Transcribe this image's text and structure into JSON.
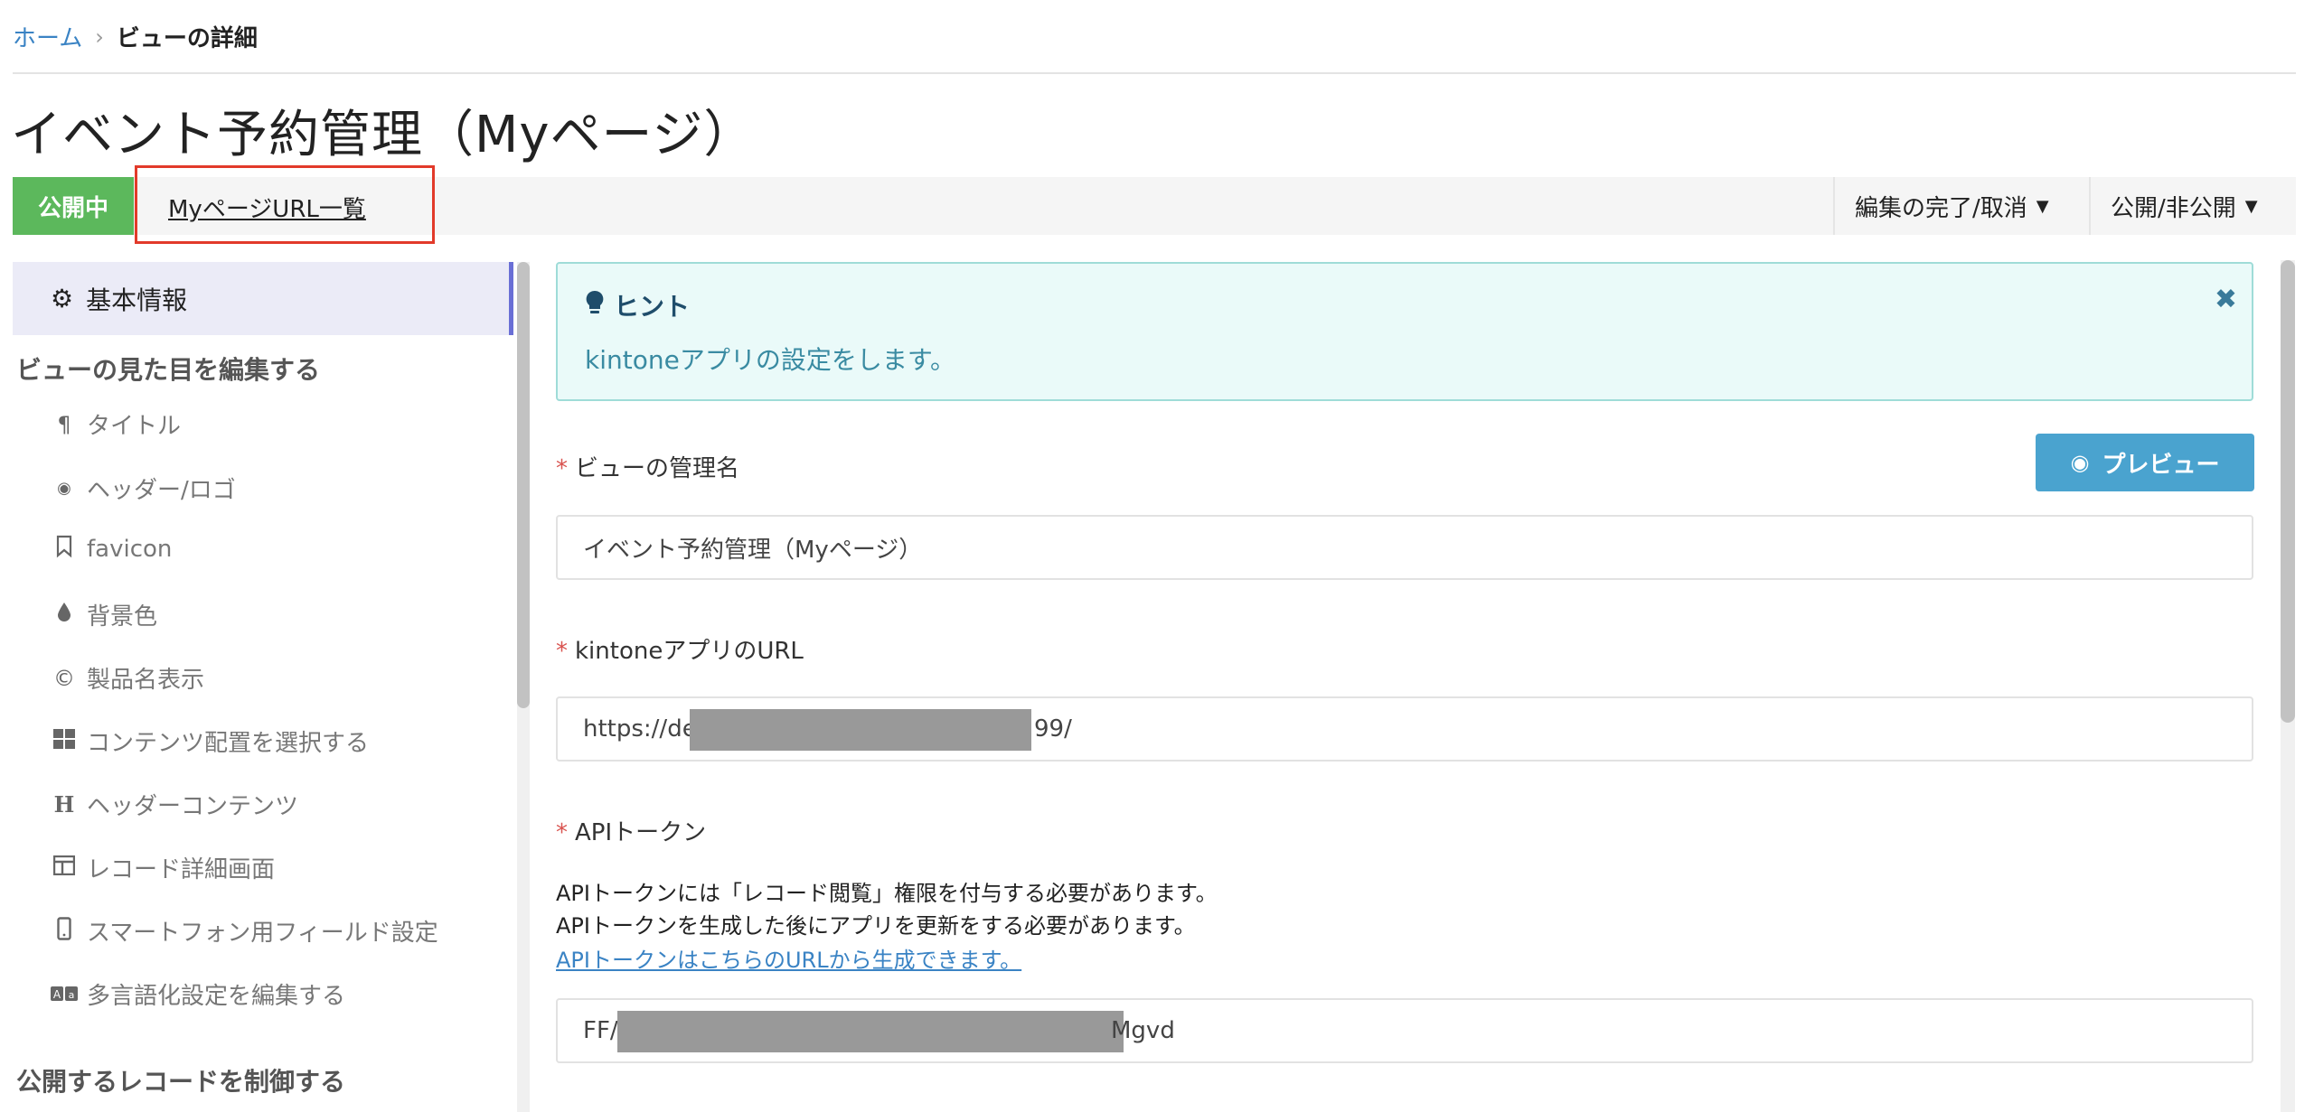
{
  "breadcrumb": {
    "home": "ホーム",
    "separator": "›",
    "current": "ビューの詳細"
  },
  "page_title": "イベント予約管理（Myページ）",
  "toolbar": {
    "status": "公開中",
    "mypage_link": "MyページURL一覧",
    "edit_dropdown": "編集の完了/取消",
    "publish_dropdown": "公開/非公開"
  },
  "sidebar": {
    "active_item": "基本情報",
    "section_appearance": "ビューの見た目を編集する",
    "items": [
      {
        "icon": "paragraph-icon",
        "label": "タイトル"
      },
      {
        "icon": "eye-icon",
        "label": "ヘッダー/ロゴ"
      },
      {
        "icon": "bookmark-icon",
        "label": "favicon"
      },
      {
        "icon": "droplet-icon",
        "label": "背景色"
      },
      {
        "icon": "copyright-icon",
        "label": "製品名表示"
      },
      {
        "icon": "grid-icon",
        "label": "コンテンツ配置を選択する"
      },
      {
        "icon": "header-icon",
        "label": "ヘッダーコンテンツ"
      },
      {
        "icon": "table-icon",
        "label": "レコード詳細画面"
      },
      {
        "icon": "mobile-icon",
        "label": "スマートフォン用フィールド設定"
      },
      {
        "icon": "language-icon",
        "label": "多言語化設定を編集する"
      }
    ],
    "section_records": "公開するレコードを制御する"
  },
  "hint": {
    "title": "ヒント",
    "text": "kintoneアプリの設定をします。"
  },
  "form": {
    "preview_button": "プレビュー",
    "view_name": {
      "label": "ビューの管理名",
      "value": "イベント予約管理（Myページ）"
    },
    "app_url": {
      "label": "kintoneアプリのURL",
      "value_start": "https://de",
      "value_end": "99/"
    },
    "api_token": {
      "label": "APIトークン",
      "help_line1": "APIトークンには「レコード閲覧」権限を付与する必要があります。",
      "help_line2": "APIトークンを生成した後にアプリを更新をする必要があります。",
      "help_link": "APIトークンはこちらのURLから生成できます。",
      "value_start": "FF/",
      "value_end": "Mgvd"
    }
  },
  "colors": {
    "status_green": "#5cb85c",
    "highlight_red": "#e23a2a",
    "accent_blue": "#4aa3cf",
    "link_blue": "#3a83c4",
    "hint_bg": "#eafaf9",
    "required_red": "#d9534f"
  }
}
